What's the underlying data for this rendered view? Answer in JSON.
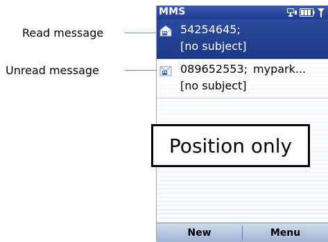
{
  "callouts": {
    "read": "Read message",
    "unread": "Unread message"
  },
  "titlebar": {
    "title": "MMS",
    "icons": [
      "network-icon",
      "battery-icon",
      "signal-icon"
    ]
  },
  "messages": [
    {
      "state": "read",
      "icon": "read-envelope-icon",
      "sender": "54254645;",
      "sender2": "",
      "subject": "[no subject]",
      "selected": true
    },
    {
      "state": "unread",
      "icon": "unread-envelope-icon",
      "sender": "089652553;",
      "sender2": "mypark...",
      "subject": "[no subject]",
      "selected": false
    }
  ],
  "overlay": {
    "text": "Position only"
  },
  "softkeys": {
    "left": "New",
    "right": "Menu"
  },
  "colors": {
    "titlebar": "#2b4a9c",
    "selection": "#1d3987",
    "callout_line": "#27b1c9"
  }
}
